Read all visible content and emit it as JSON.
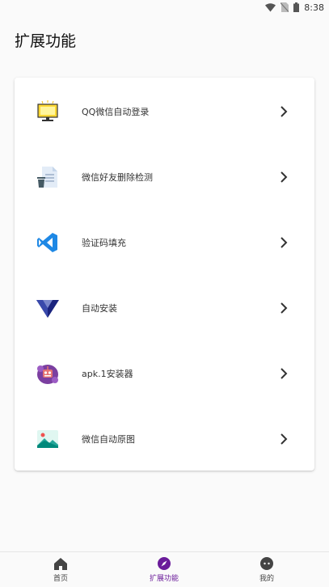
{
  "status_bar": {
    "time": "8:38"
  },
  "page": {
    "title": "扩展功能"
  },
  "features": [
    {
      "label": "QQ微信自动登录",
      "icon": "monitor-icon"
    },
    {
      "label": "微信好友删除检测",
      "icon": "document-trash-icon"
    },
    {
      "label": "验证码填充",
      "icon": "vscode-icon"
    },
    {
      "label": "自动安装",
      "icon": "triangle-logo-icon"
    },
    {
      "label": "apk.1安装器",
      "icon": "robot-icon"
    },
    {
      "label": "微信自动原图",
      "icon": "image-icon"
    }
  ],
  "bottom_nav": [
    {
      "label": "首页",
      "icon": "home-icon"
    },
    {
      "label": "扩展功能",
      "icon": "compass-icon"
    },
    {
      "label": "我的",
      "icon": "chat-icon"
    }
  ],
  "colors": {
    "accent": "#6a1b9a"
  }
}
